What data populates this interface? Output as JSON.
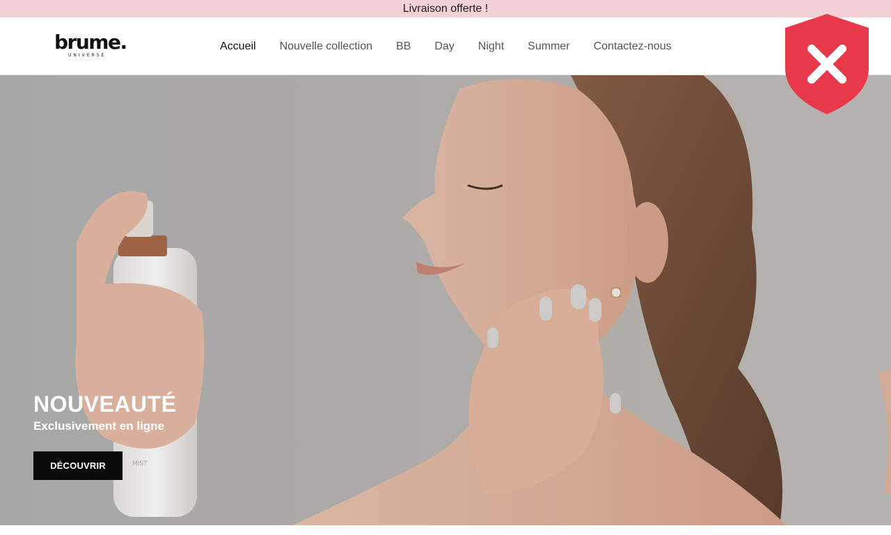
{
  "announcement": {
    "text": "Livraison offerte !"
  },
  "header": {
    "logo": {
      "word": "brume.",
      "sub": "UNIVERSE"
    },
    "nav": [
      {
        "label": "Accueil",
        "active": true
      },
      {
        "label": "Nouvelle collection",
        "active": false
      },
      {
        "label": "BB",
        "active": false
      },
      {
        "label": "Day",
        "active": false
      },
      {
        "label": "Night",
        "active": false
      },
      {
        "label": "Summer",
        "active": false
      },
      {
        "label": "Contactez-nous",
        "active": false
      }
    ]
  },
  "overlay": {
    "icon": "shield-x-icon",
    "color": "#e8394a"
  },
  "hero": {
    "title": "NOUVEAUTÉ",
    "subtitle": "Exclusivement en ligne",
    "button_label": "DÉCOUVRIR",
    "image": "woman-spraying-face-mist-image"
  },
  "colors": {
    "announcement_bg": "#f2d2d7",
    "button_bg": "#0a0a0a",
    "hero_bg": "#b7b5b3"
  }
}
